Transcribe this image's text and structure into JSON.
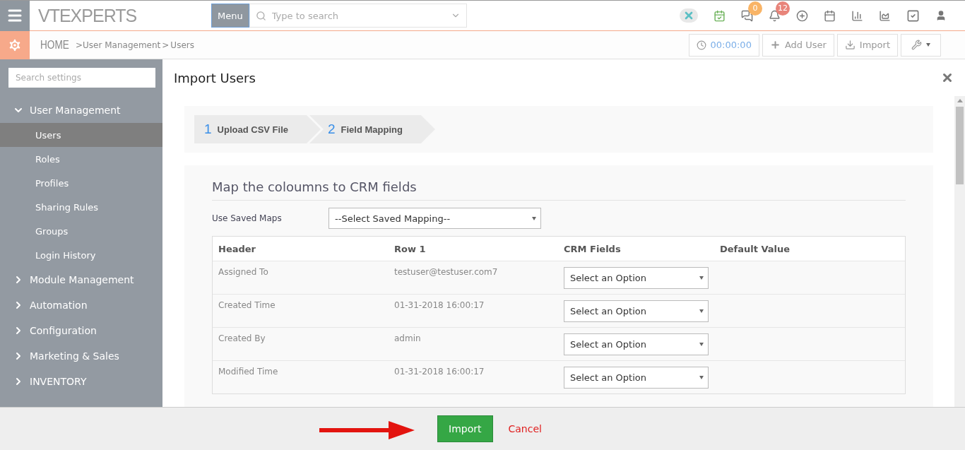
{
  "topbar": {
    "logo": "VTEXPERTS",
    "menu_button": "Menu",
    "search": {
      "placeholder": "Type to search"
    },
    "badges": [
      {
        "kind": "chat",
        "count": "0",
        "color": "#f9b466"
      },
      {
        "kind": "bell",
        "count": "12",
        "color": "#e8847a"
      }
    ]
  },
  "breadcrumb": {
    "home": "HOME",
    "items": [
      ">User Management",
      ">",
      "Users"
    ]
  },
  "toolbar": {
    "timer": "00:00:00",
    "buttons": [
      "Add User",
      "Import"
    ]
  },
  "sidebar": {
    "search": {
      "placeholder": "Search settings"
    },
    "sections": [
      {
        "label": "User Management",
        "expanded": true,
        "children": [
          {
            "label": "Users",
            "selected": true
          },
          {
            "label": "Roles",
            "selected": false
          },
          {
            "label": "Profiles",
            "selected": false
          },
          {
            "label": "Sharing Rules",
            "selected": false
          },
          {
            "label": "Groups",
            "selected": false
          },
          {
            "label": "Login History",
            "selected": false
          }
        ]
      },
      {
        "label": "Module Management",
        "expanded": false
      },
      {
        "label": "Automation",
        "expanded": false
      },
      {
        "label": "Configuration",
        "expanded": false
      },
      {
        "label": "Marketing & Sales",
        "expanded": false
      },
      {
        "label": "INVENTORY",
        "expanded": false
      }
    ]
  },
  "modal": {
    "title": "Import Users",
    "steps": [
      {
        "number": "1",
        "label": "Upload CSV File"
      },
      {
        "number": "2",
        "label": "Field Mapping"
      }
    ],
    "heading": "Map the coloumns to CRM fields",
    "saved_maps": {
      "label": "Use Saved Maps",
      "value": "--Select Saved Mapping--"
    },
    "table": {
      "columns": [
        "Header",
        "Row 1",
        "CRM Fields",
        "Default Value"
      ],
      "rows": [
        {
          "header": "Assigned To",
          "row_1": "testuser@testuser.com7",
          "crm_field": "Select an Option"
        },
        {
          "header": "Created Time",
          "row_1": "01-31-2018 16:00:17",
          "crm_field": "Select an Option"
        },
        {
          "header": "Created By",
          "row_1": "admin",
          "crm_field": "Select an Option"
        },
        {
          "header": "Modified Time",
          "row_1": "01-31-2018 16:00:17",
          "crm_field": "Select an Option"
        }
      ]
    }
  },
  "footer": {
    "primary": "Import",
    "cancel": "Cancel"
  }
}
